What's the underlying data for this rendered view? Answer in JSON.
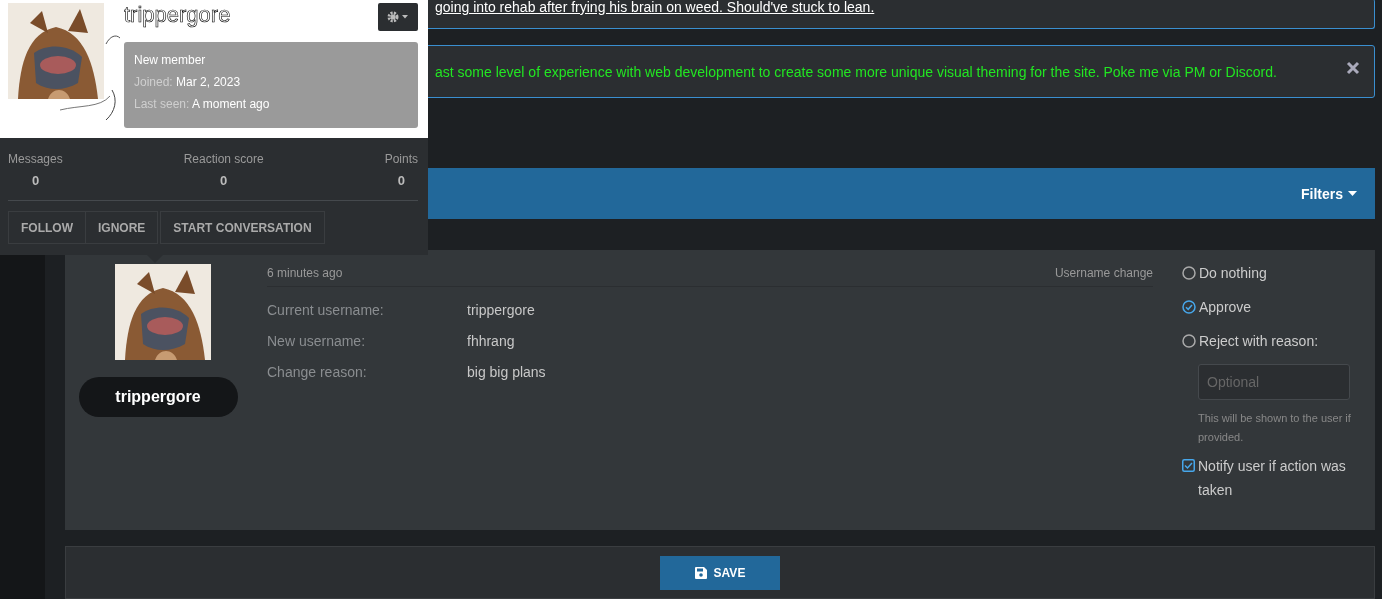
{
  "notices": [
    {
      "kind": "link",
      "text": "going into rehab after frying his brain on weed. Should've stuck to lean.",
      "dismissible": false
    },
    {
      "kind": "info",
      "text": "ast some level of experience with web development to create some more unique visual theming for the site. Poke me via PM or Discord.",
      "dismissible": true
    }
  ],
  "filter_bar": {
    "filters": "Filters"
  },
  "profile_card": {
    "name": "trippergore",
    "role": "New member",
    "joined_label": "Joined:",
    "joined": "Mar 2, 2023",
    "last_seen_label": "Last seen:",
    "last_seen": "A moment ago",
    "stats": [
      {
        "label": "Messages",
        "value": "0"
      },
      {
        "label": "Reaction score",
        "value": "0"
      },
      {
        "label": "Points",
        "value": "0"
      }
    ],
    "actions": [
      "FOLLOW",
      "IGNORE",
      "START CONVERSATION"
    ]
  },
  "request": {
    "username": "trippergore",
    "time": "6 minutes ago",
    "type": "Username change",
    "fields": [
      {
        "label": "Current username:",
        "value": "trippergore"
      },
      {
        "label": "New username:",
        "value": "fhhrang"
      },
      {
        "label": "Change reason:",
        "value": "big big plans"
      }
    ],
    "options": [
      {
        "label": "Do nothing",
        "selected": false
      },
      {
        "label": "Approve",
        "selected": true
      },
      {
        "label": "Reject with reason:",
        "selected": false
      }
    ],
    "reason": {
      "placeholder": "Optional",
      "hint": "This will be shown to the user if provided."
    },
    "notify": {
      "label": "Notify user if action was taken",
      "checked": true
    }
  },
  "save_button": "SAVE"
}
